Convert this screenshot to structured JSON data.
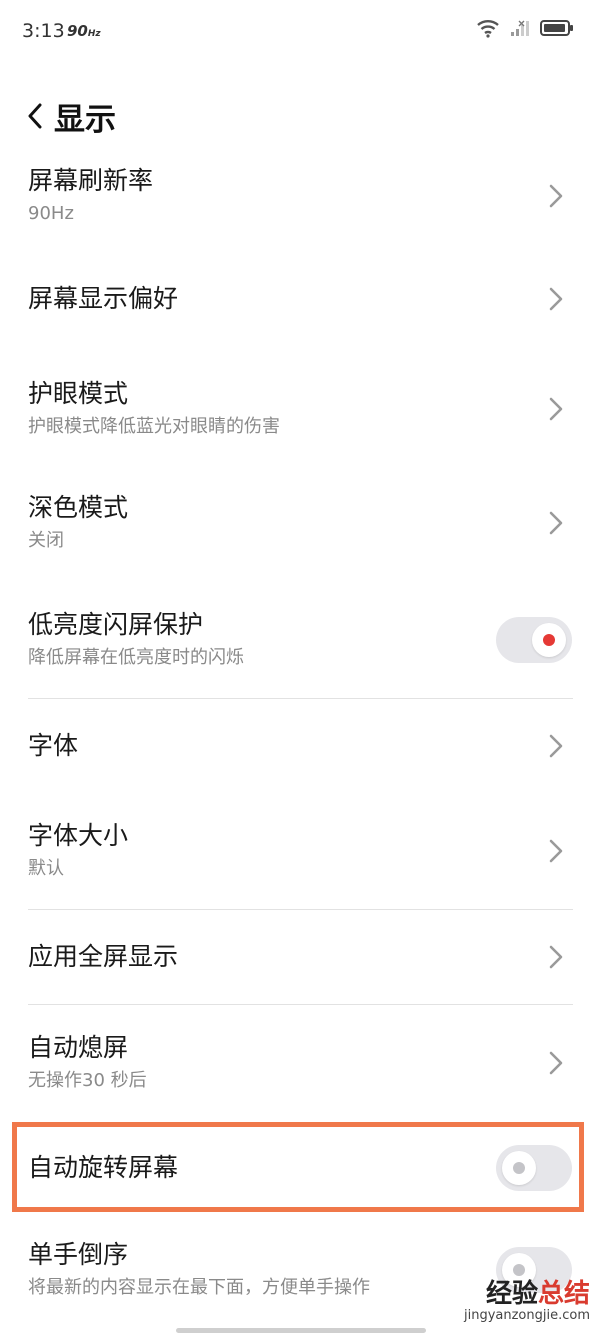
{
  "status_bar": {
    "time": "3:13",
    "refresh_rate": "90",
    "refresh_unit": "Hz",
    "icons": [
      "wifi-icon",
      "cellular-signal-icon",
      "battery-icon"
    ]
  },
  "header": {
    "title": "显示",
    "back_icon": "chevron-left-icon"
  },
  "settings": [
    {
      "title": "屏幕刷新率",
      "subtitle": "90Hz",
      "control": "chevron"
    },
    {
      "title": "屏幕显示偏好",
      "subtitle": "",
      "control": "chevron"
    },
    {
      "title": "护眼模式",
      "subtitle": "护眼模式降低蓝光对眼睛的伤害",
      "control": "chevron"
    },
    {
      "title": "深色模式",
      "subtitle": "关闭",
      "control": "chevron"
    },
    {
      "title": "低亮度闪屏保护",
      "subtitle": "降低屏幕在低亮度时的闪烁",
      "control": "toggle",
      "on": true
    },
    {
      "title": "字体",
      "subtitle": "",
      "control": "chevron"
    },
    {
      "title": "字体大小",
      "subtitle": "默认",
      "control": "chevron"
    },
    {
      "title": "应用全屏显示",
      "subtitle": "",
      "control": "chevron"
    },
    {
      "title": "自动熄屏",
      "subtitle": "无操作30 秒后",
      "control": "chevron"
    },
    {
      "title": "自动旋转屏幕",
      "subtitle": "",
      "control": "toggle",
      "on": false,
      "highlighted": true
    },
    {
      "title": "单手倒序",
      "subtitle": "将最新的内容显示在最下面，方便单手操作",
      "control": "toggle",
      "on": false
    }
  ],
  "watermark": {
    "text_a": "经验",
    "text_b": "总结",
    "url": "jingyanzongjie.com"
  },
  "colors": {
    "toggle_on_dot": "#e53935",
    "toggle_off_dot": "#c4c4c8",
    "highlight_border": "#f0784a",
    "chevron": "#9a9a9a"
  }
}
